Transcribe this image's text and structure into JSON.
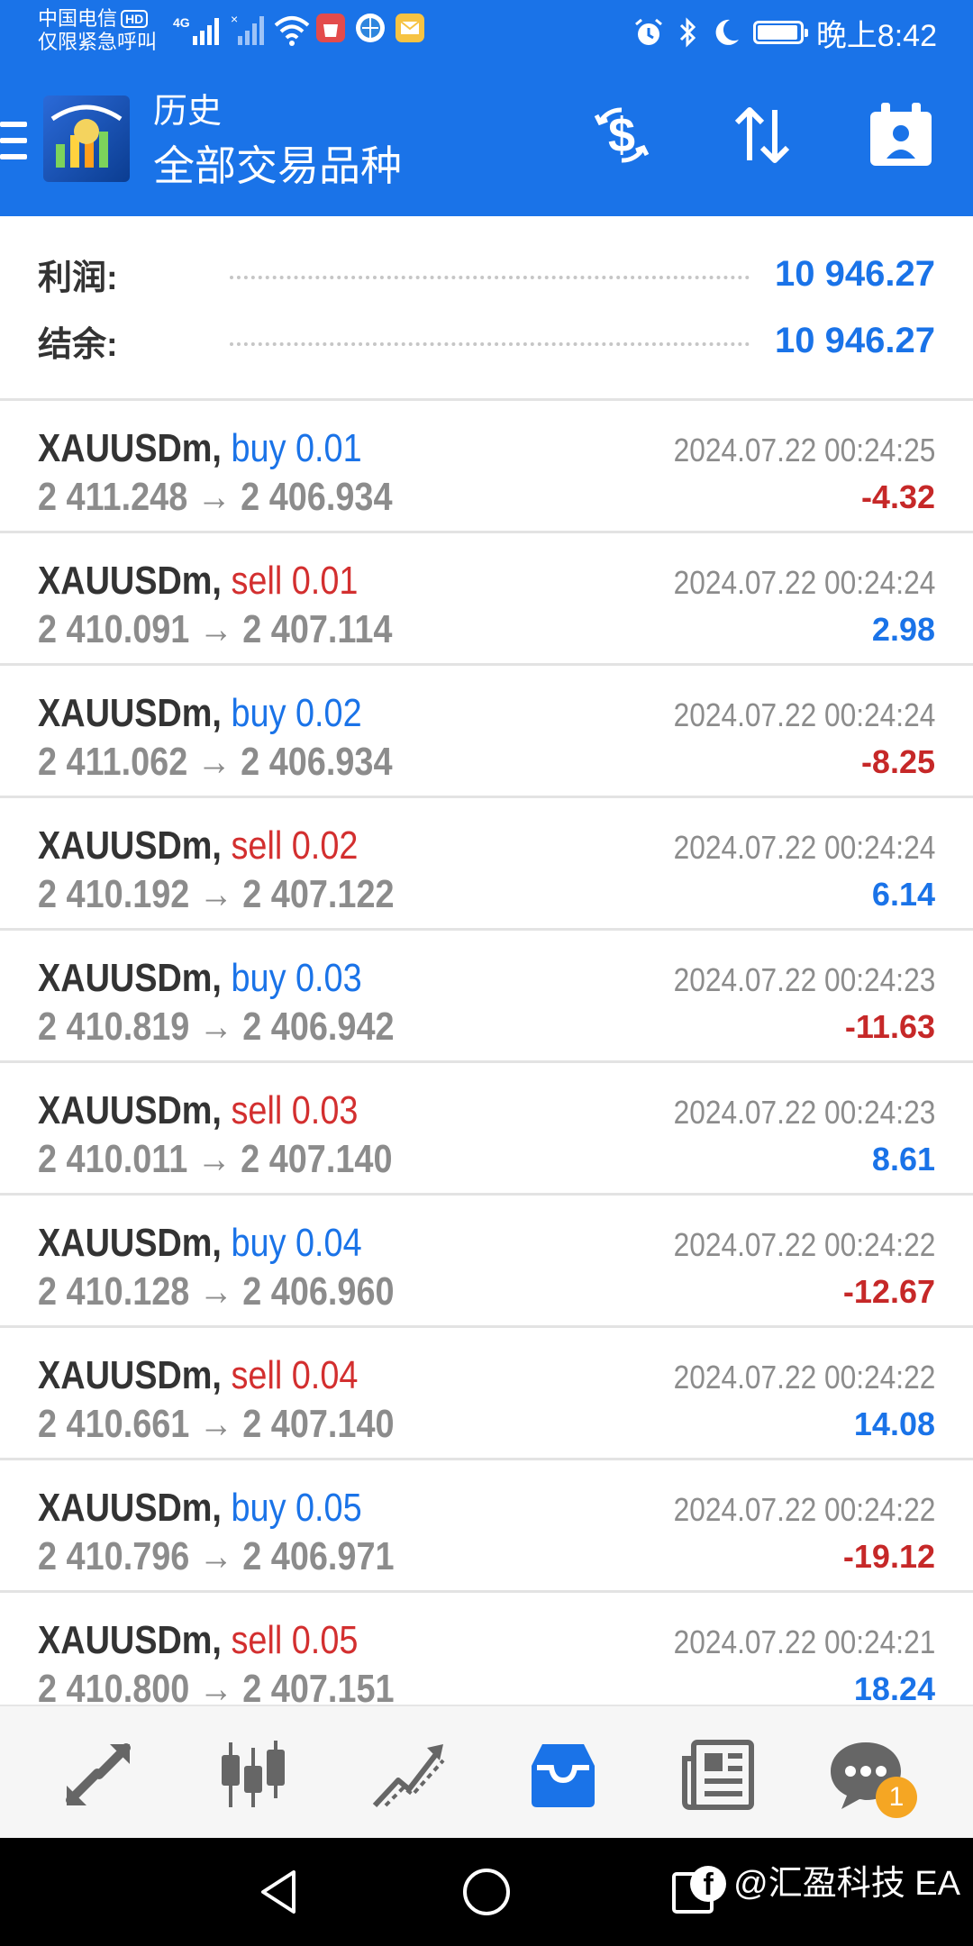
{
  "status_bar": {
    "carrier_line1": "中国电信",
    "carrier_hd": "HD",
    "carrier_line2": "仅限紧急呼叫",
    "network": "4G",
    "time": "晚上8:42"
  },
  "app_bar": {
    "title_small": "历史",
    "title_big": "全部交易品种",
    "colors": {
      "primary": "#1a73e8"
    }
  },
  "summary": {
    "profit_label": "利润:",
    "profit_value": "10 946.27",
    "balance_label": "结余:",
    "balance_value": "10 946.27"
  },
  "trades": [
    {
      "symbol": "XAUUSDm,",
      "action": "buy 0.01",
      "type": "buy",
      "open": "2 411.248",
      "close": "2 406.934",
      "time": "2024.07.22 00:24:25",
      "profit": "-4.32",
      "sign": "neg"
    },
    {
      "symbol": "XAUUSDm,",
      "action": "sell 0.01",
      "type": "sell",
      "open": "2 410.091",
      "close": "2 407.114",
      "time": "2024.07.22 00:24:24",
      "profit": "2.98",
      "sign": "pos"
    },
    {
      "symbol": "XAUUSDm,",
      "action": "buy 0.02",
      "type": "buy",
      "open": "2 411.062",
      "close": "2 406.934",
      "time": "2024.07.22 00:24:24",
      "profit": "-8.25",
      "sign": "neg"
    },
    {
      "symbol": "XAUUSDm,",
      "action": "sell 0.02",
      "type": "sell",
      "open": "2 410.192",
      "close": "2 407.122",
      "time": "2024.07.22 00:24:24",
      "profit": "6.14",
      "sign": "pos"
    },
    {
      "symbol": "XAUUSDm,",
      "action": "buy 0.03",
      "type": "buy",
      "open": "2 410.819",
      "close": "2 406.942",
      "time": "2024.07.22 00:24:23",
      "profit": "-11.63",
      "sign": "neg"
    },
    {
      "symbol": "XAUUSDm,",
      "action": "sell 0.03",
      "type": "sell",
      "open": "2 410.011",
      "close": "2 407.140",
      "time": "2024.07.22 00:24:23",
      "profit": "8.61",
      "sign": "pos"
    },
    {
      "symbol": "XAUUSDm,",
      "action": "buy 0.04",
      "type": "buy",
      "open": "2 410.128",
      "close": "2 406.960",
      "time": "2024.07.22 00:24:22",
      "profit": "-12.67",
      "sign": "neg"
    },
    {
      "symbol": "XAUUSDm,",
      "action": "sell 0.04",
      "type": "sell",
      "open": "2 410.661",
      "close": "2 407.140",
      "time": "2024.07.22 00:24:22",
      "profit": "14.08",
      "sign": "pos"
    },
    {
      "symbol": "XAUUSDm,",
      "action": "buy 0.05",
      "type": "buy",
      "open": "2 410.796",
      "close": "2 406.971",
      "time": "2024.07.22 00:24:22",
      "profit": "-19.12",
      "sign": "neg"
    },
    {
      "symbol": "XAUUSDm,",
      "action": "sell 0.05",
      "type": "sell",
      "open": "2 410.800",
      "close": "2 407.151",
      "time": "2024.07.22 00:24:21",
      "profit": "18.24",
      "sign": "pos"
    }
  ],
  "arrow": "→",
  "bottom_nav": {
    "items": [
      "quotes-icon",
      "chart-icon",
      "trade-icon",
      "history-icon",
      "news-icon",
      "messages-icon"
    ],
    "active": "history-icon",
    "messages_badge": "1"
  },
  "watermark": {
    "fb_glyph": "f",
    "text": "@汇盈科技 EA"
  }
}
